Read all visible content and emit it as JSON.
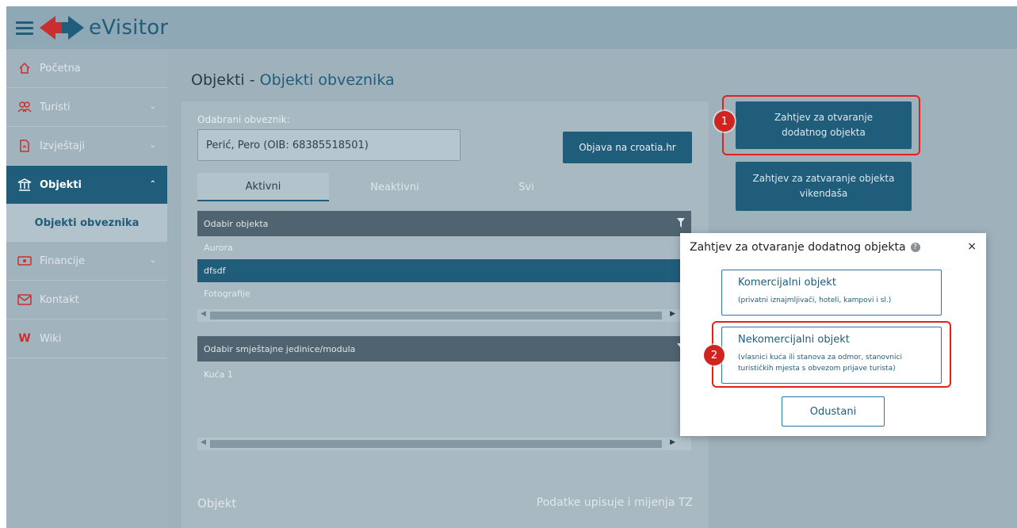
{
  "app": {
    "name": "eVisitor",
    "menu_icon": "hamburger-icon",
    "logo_icon": "evisitor-logo-arrows",
    "colors": {
      "primary": "#1f5d7b",
      "highlight": "#e0221d",
      "wiki": "#c8302f"
    }
  },
  "sidebar": {
    "items": [
      {
        "label": "Početna",
        "icon": "home-icon"
      },
      {
        "label": "Turisti",
        "icon": "users-icon"
      },
      {
        "label": "Izvještaji",
        "icon": "report-icon"
      },
      {
        "label": "Objekti",
        "icon": "building-icon"
      },
      {
        "label": "Objekti obveznika"
      },
      {
        "label": "Financije",
        "icon": "money-icon"
      },
      {
        "label": "Kontakt",
        "icon": "mail-icon"
      },
      {
        "label": "Wiki",
        "icon": "W"
      }
    ]
  },
  "page": {
    "title": "Objekti",
    "separator": " - ",
    "subtitle": "Objekti obveznika"
  },
  "obveznik": {
    "label": "Odabrani obveznik:",
    "value": "Perić, Pero (OIB: 68385518501)",
    "objava_button": "Objava na croatia.hr"
  },
  "tabs": [
    "Aktivni",
    "Neaktivni",
    "Svi"
  ],
  "grid1": {
    "header": "Odabir objekta",
    "rows": [
      "Aurora",
      "dfsdf",
      "Fotografije"
    ],
    "selected": "dfsdf"
  },
  "grid2": {
    "header": "Odabir smještajne jedinice/modula",
    "rows": [
      "Kuća 1"
    ]
  },
  "section2": {
    "left": "Objekt",
    "right": "Podatke upisuje i mijenja TZ"
  },
  "actions": {
    "open_line1": "Zahtjev za otvaranje",
    "open_line2": "dodatnog objekta",
    "close_line1": "Zahtjev za zatvaranje objekta",
    "close_line2": "vikendaša"
  },
  "badges": {
    "b1": "1",
    "b2": "2"
  },
  "modal": {
    "title": "Zahtjev za otvaranje dodatnog objekta",
    "help_icon": "?",
    "close": "×",
    "opt1_title": "Komercijalni objekt",
    "opt1_desc": "(privatni iznajmljivači, hoteli, kampovi i sl.)",
    "opt2_title": "Nekomercijalni objekt",
    "opt2_desc1": "(vlasnici kuća ili stanova za odmor, stanovnici",
    "opt2_desc2": "turističkih mjesta s obvezom prijave turista)",
    "cancel": "Odustani"
  }
}
